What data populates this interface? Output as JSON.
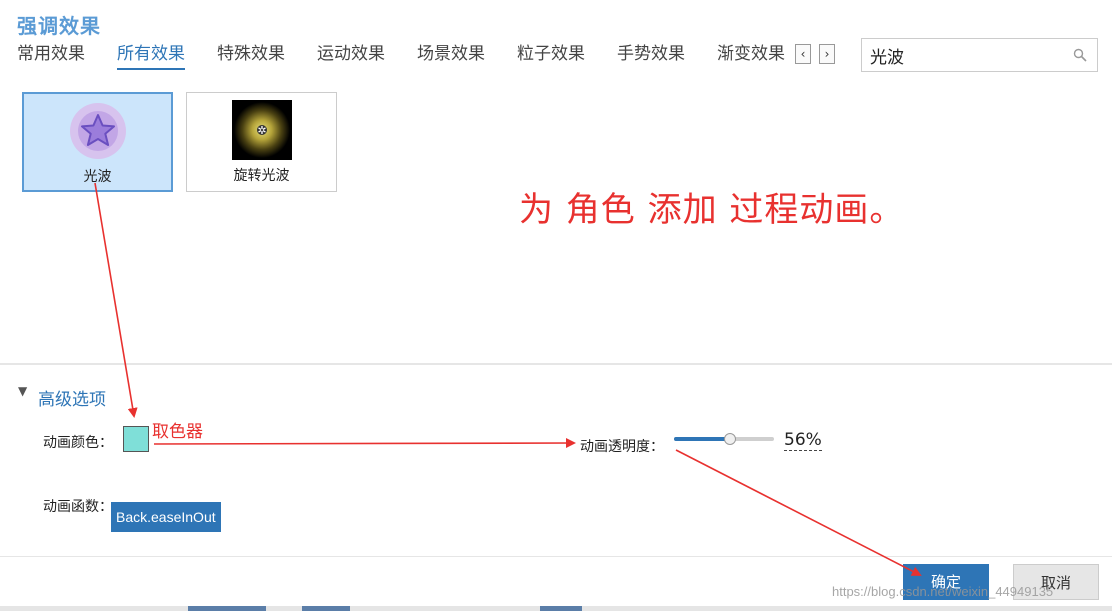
{
  "dialog": {
    "title": "强调效果"
  },
  "tabs": [
    {
      "label": "常用效果",
      "active": false
    },
    {
      "label": "所有效果",
      "active": true
    },
    {
      "label": "特殊效果",
      "active": false
    },
    {
      "label": "运动效果",
      "active": false
    },
    {
      "label": "场景效果",
      "active": false
    },
    {
      "label": "粒子效果",
      "active": false
    },
    {
      "label": "手势效果",
      "active": false
    },
    {
      "label": "渐变效果",
      "active": false
    }
  ],
  "tab_nav": {
    "prev_icon": "chevron-left-icon",
    "next_icon": "chevron-right-icon"
  },
  "search": {
    "value": "光波",
    "icon": "search-icon"
  },
  "effects": [
    {
      "label": "光波",
      "selected": true,
      "icon": "star-icon"
    },
    {
      "label": "旋转光波",
      "selected": false,
      "icon": "glow-icon"
    }
  ],
  "annotations": {
    "headline": "为 角色 添加 过程动画。",
    "color_picker_note": "取色器"
  },
  "advanced": {
    "toggle_icon": "triangle-down-icon",
    "title": "高级选项",
    "color_label": "动画颜色：",
    "color_value": "#7fdfd8",
    "opacity_label": "动画透明度：",
    "opacity_value": 0.56,
    "opacity_text": "56%",
    "easing_label": "动画函数：",
    "easing_value": "Back.easeInOut"
  },
  "buttons": {
    "ok": "确定",
    "cancel": "取消"
  },
  "watermark": "https://blog.csdn.net/weixin_44949135",
  "colors": {
    "accent": "#2e75b6",
    "annotation_red": "#e8312f",
    "selection_bg": "#cce5fb"
  }
}
